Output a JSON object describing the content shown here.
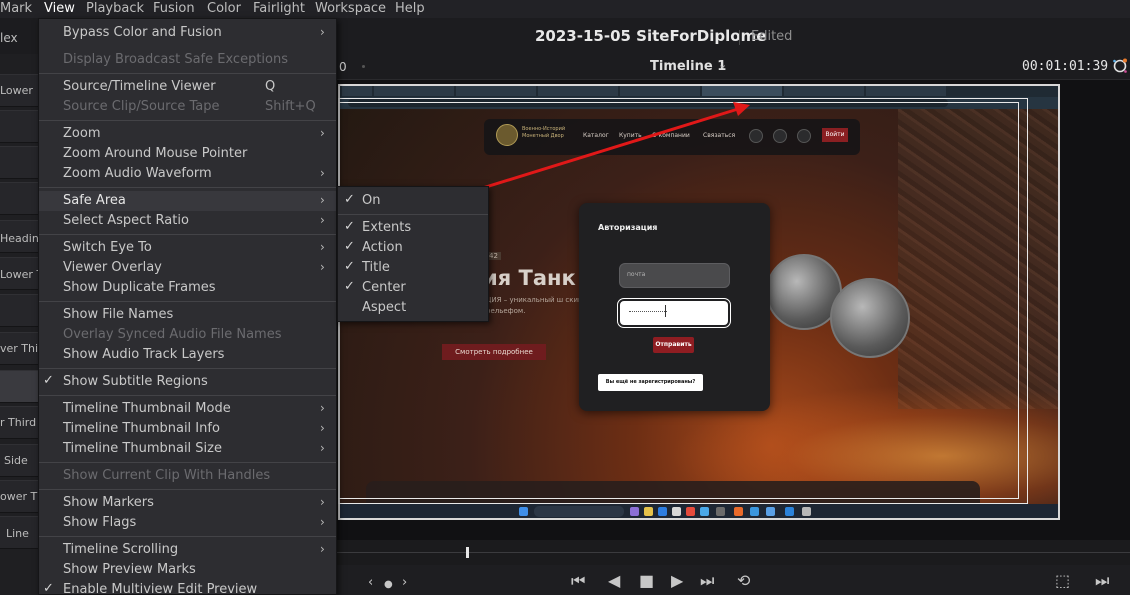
{
  "menubar": {
    "items": [
      "Mark",
      "View",
      "Playback",
      "Fusion",
      "Color",
      "Fairlight",
      "Workspace",
      "Help"
    ],
    "active": "View"
  },
  "titlebar": {
    "left_label": "lex",
    "project_name": "2023-15-05 SiteForDiplome",
    "status": "Edited"
  },
  "viewer_header": {
    "left_value": "0",
    "timeline_name": "Timeline 1",
    "timecode": "00:01:01:39"
  },
  "left_panel": {
    "labels": [
      "Lower",
      "Heading",
      "Lower T",
      "ver Third",
      "r Third",
      "Side",
      "ower Thi",
      "Line"
    ]
  },
  "view_menu": {
    "items": [
      {
        "label": "Bypass Color and Fusion",
        "submenu": true
      },
      {
        "label": "Display Broadcast Safe Exceptions",
        "disabled": true
      },
      {
        "label": "Source/Timeline Viewer",
        "shortcut": "Q"
      },
      {
        "label": "Source Clip/Source Tape",
        "shortcut": "Shift+Q",
        "disabled": true
      },
      {
        "label": "Zoom",
        "submenu": true
      },
      {
        "label": "Zoom Around Mouse Pointer"
      },
      {
        "label": "Zoom Audio Waveform",
        "submenu": true
      },
      {
        "label": "Safe Area",
        "submenu": true,
        "highlighted": true
      },
      {
        "label": "Select Aspect Ratio",
        "submenu": true
      },
      {
        "label": "Switch Eye To",
        "submenu": true
      },
      {
        "label": "Viewer Overlay",
        "submenu": true
      },
      {
        "label": "Show Duplicate Frames"
      },
      {
        "label": "Show File Names"
      },
      {
        "label": "Overlay Synced Audio File Names",
        "disabled": true
      },
      {
        "label": "Show Audio Track Layers"
      },
      {
        "label": "Show Subtitle Regions",
        "checked": true
      },
      {
        "label": "Timeline Thumbnail Mode",
        "submenu": true
      },
      {
        "label": "Timeline Thumbnail Info",
        "submenu": true
      },
      {
        "label": "Timeline Thumbnail Size",
        "submenu": true
      },
      {
        "label": "Show Current Clip With Handles",
        "disabled": true
      },
      {
        "label": "Show Markers",
        "submenu": true
      },
      {
        "label": "Show Flags",
        "submenu": true
      },
      {
        "label": "Timeline Scrolling",
        "submenu": true
      },
      {
        "label": "Show Preview Marks"
      },
      {
        "label": "Enable Multiview Edit Preview",
        "checked": true
      }
    ]
  },
  "safe_area_submenu": {
    "items": [
      {
        "label": "On",
        "checked": true
      },
      {
        "label": "Extents",
        "checked": true
      },
      {
        "label": "Action",
        "checked": true
      },
      {
        "label": "Title",
        "checked": true
      },
      {
        "label": "Center",
        "checked": true
      },
      {
        "label": "Aspect",
        "checked": false
      }
    ]
  },
  "website": {
    "logo_text": "Военно-Историй Монетный Двор",
    "nav": [
      "Каталог",
      "Купить",
      "О компании",
      "Связаться"
    ],
    "login_button": "Войти",
    "hero_badge": "42",
    "hero_title": "ия Танк",
    "hero_subtitle": "ЦИЯ – уникальный ш ским рельефом.",
    "more_button": "Смотреть подробнее",
    "auth_title": "Авторизация",
    "email_placeholder": "почта",
    "submit_button": "Отправить",
    "register_button": "Вы ещё не зарегистрированы?"
  },
  "colors": {
    "accent_red": "#8f1d22",
    "menu_bg": "#2d2d31",
    "menu_highlight": "#38383d",
    "arrow_red": "#e01818"
  },
  "icons": {
    "fx": "fx-icon",
    "transport": [
      "go-to-start-icon",
      "previous-frame-icon",
      "stop-icon",
      "play-icon",
      "go-to-end-icon",
      "loop-icon"
    ],
    "right": [
      "match-frame-icon",
      "next-edit-icon"
    ]
  }
}
